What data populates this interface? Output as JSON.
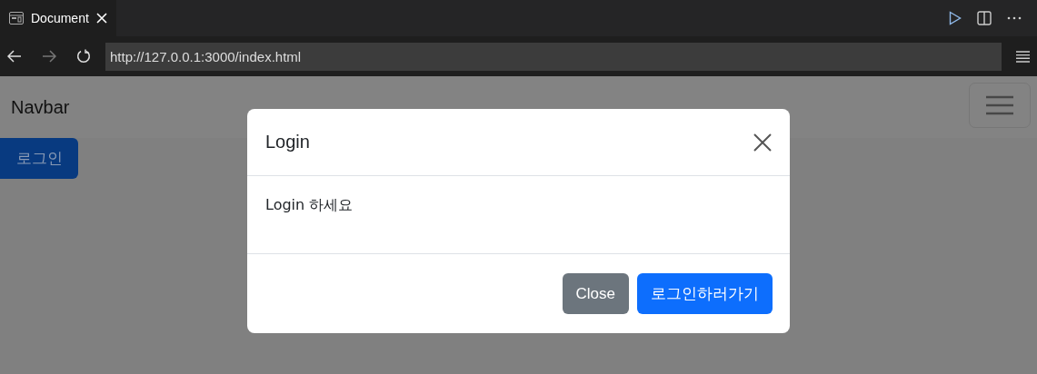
{
  "browser": {
    "tab": {
      "title": "Document",
      "selected": true
    },
    "url": "http://127.0.0.1:3000/index.html",
    "forward_disabled": true
  },
  "navbar": {
    "brand": "Navbar"
  },
  "login_button": "로그인",
  "modal": {
    "title": "Login",
    "body": "Login 하세요",
    "buttons": [
      {
        "label": "Close",
        "kind": "secondary"
      },
      {
        "label": "로그인하러가기",
        "kind": "primary"
      }
    ]
  }
}
